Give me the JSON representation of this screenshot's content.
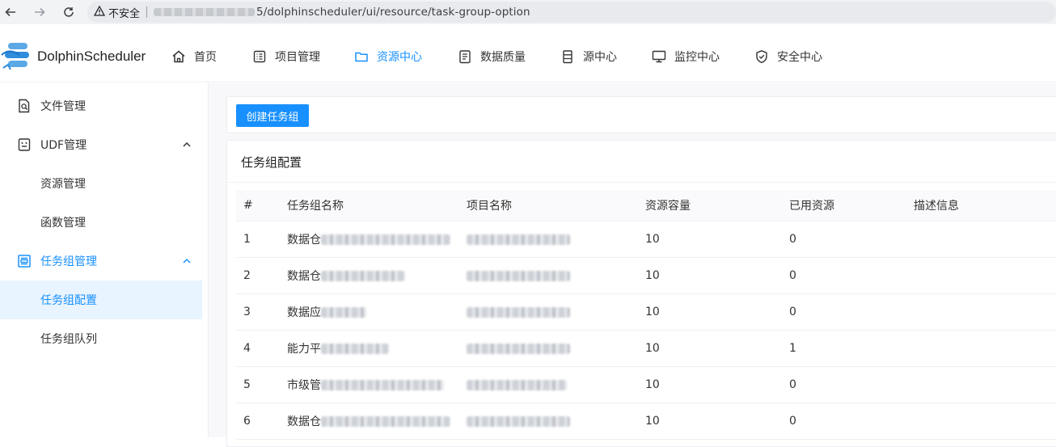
{
  "browser": {
    "not_secure_label": "不安全",
    "url_path": "5/dolphinscheduler/ui/resource/task-group-option"
  },
  "app": {
    "logo_text": "DolphinScheduler",
    "menu": [
      {
        "label": "首页",
        "icon": "home-icon"
      },
      {
        "label": "项目管理",
        "icon": "project-icon"
      },
      {
        "label": "资源中心",
        "icon": "folder-icon",
        "active": true
      },
      {
        "label": "数据质量",
        "icon": "data-quality-icon"
      },
      {
        "label": "源中心",
        "icon": "datasource-icon"
      },
      {
        "label": "监控中心",
        "icon": "monitor-icon"
      },
      {
        "label": "安全中心",
        "icon": "shield-icon"
      }
    ]
  },
  "sidebar": {
    "items": [
      {
        "label": "文件管理",
        "icon": "file-search-icon"
      },
      {
        "label": "UDF管理",
        "icon": "udf-icon"
      },
      {
        "label": "资源管理"
      },
      {
        "label": "函数管理"
      },
      {
        "label": "任务组管理",
        "icon": "task-group-icon"
      },
      {
        "label": "任务组配置"
      },
      {
        "label": "任务组队列"
      }
    ]
  },
  "toolbar": {
    "create_label": "创建任务组"
  },
  "card": {
    "title": "任务组配置"
  },
  "table": {
    "headers": [
      "#",
      "任务组名称",
      "项目名称",
      "资源容量",
      "已用资源",
      "描述信息"
    ],
    "rows": [
      {
        "index": "1",
        "name": "数据仓",
        "capacity": "10",
        "used": "0",
        "desc": ""
      },
      {
        "index": "2",
        "name": "数据仓",
        "capacity": "10",
        "used": "0",
        "desc": ""
      },
      {
        "index": "3",
        "name": "数据应",
        "capacity": "10",
        "used": "0",
        "desc": ""
      },
      {
        "index": "4",
        "name": "能力平",
        "capacity": "10",
        "used": "1",
        "desc": ""
      },
      {
        "index": "5",
        "name": "市级管",
        "capacity": "10",
        "used": "0",
        "desc": ""
      },
      {
        "index": "6",
        "name": "数据仓",
        "capacity": "10",
        "used": "0",
        "desc": ""
      }
    ]
  },
  "colors": {
    "accent": "#1890ff",
    "selected_bg": "#e8f4ff"
  }
}
